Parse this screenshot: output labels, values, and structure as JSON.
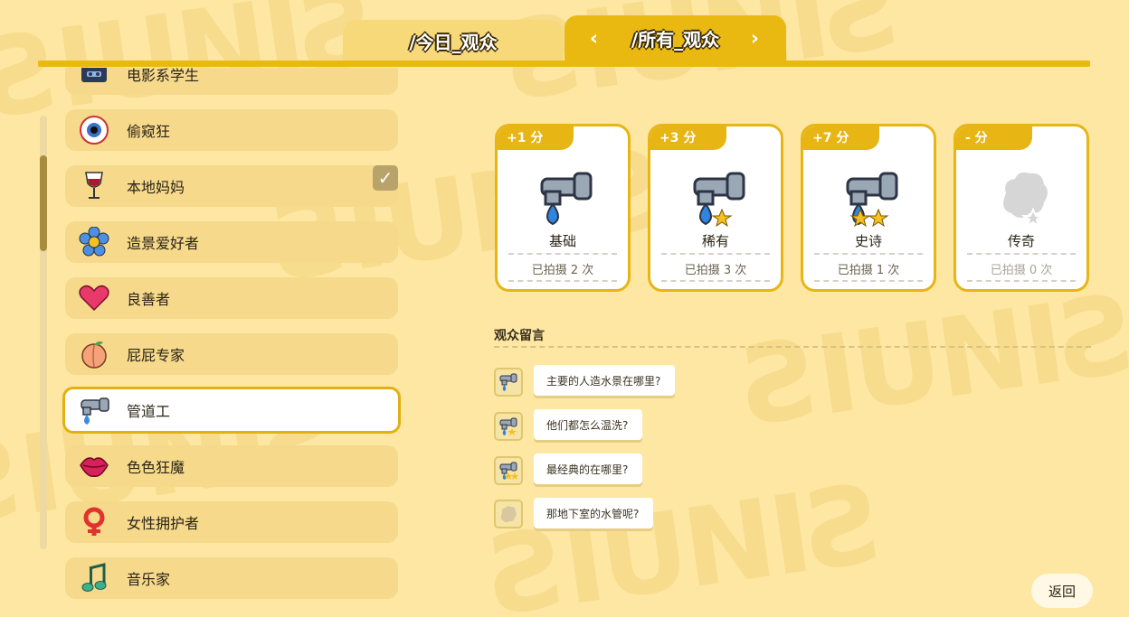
{
  "tabs": {
    "today": "/今日_观众",
    "all": "/所有_观众",
    "prev_arrow": "‹",
    "next_arrow": "›"
  },
  "audience_list": [
    {
      "label": "电影系学生",
      "icon": "cassette-icon",
      "checked": false,
      "selected": false
    },
    {
      "label": "偷窥狂",
      "icon": "eyeball-icon",
      "checked": false,
      "selected": false
    },
    {
      "label": "本地妈妈",
      "icon": "wine-glass-icon",
      "checked": true,
      "selected": false
    },
    {
      "label": "造景爱好者",
      "icon": "flower-icon",
      "checked": false,
      "selected": false
    },
    {
      "label": "良善者",
      "icon": "heart-icon",
      "checked": false,
      "selected": false
    },
    {
      "label": "屁屁专家",
      "icon": "peach-icon",
      "checked": false,
      "selected": false
    },
    {
      "label": "管道工",
      "icon": "faucet-icon",
      "checked": false,
      "selected": true
    },
    {
      "label": "色色狂魔",
      "icon": "lips-icon",
      "checked": false,
      "selected": false
    },
    {
      "label": "女性拥护者",
      "icon": "female-symbol-icon",
      "checked": false,
      "selected": false
    },
    {
      "label": "音乐家",
      "icon": "music-note-icon",
      "checked": false,
      "selected": false
    }
  ],
  "rarity_cards": [
    {
      "points": "+1 分",
      "name": "基础",
      "count": "已拍摄 2 次",
      "stars": 0,
      "locked": false
    },
    {
      "points": "+3 分",
      "name": "稀有",
      "count": "已拍摄 3 次",
      "stars": 1,
      "locked": false
    },
    {
      "points": "+7 分",
      "name": "史诗",
      "count": "已拍摄 1 次",
      "stars": 2,
      "locked": false
    },
    {
      "points": "- 分",
      "name": "传奇",
      "count": "已拍摄 0 次",
      "stars": 0,
      "locked": true
    }
  ],
  "comments": {
    "title": "观众留言",
    "items": [
      {
        "text": "主要的人造水景在哪里?",
        "stars": 0,
        "locked": false
      },
      {
        "text": "他们都怎么温洗?",
        "stars": 1,
        "locked": false
      },
      {
        "text": "最经典的在哪里?",
        "stars": 2,
        "locked": false
      },
      {
        "text": "那地下室的水管呢?",
        "stars": 0,
        "locked": true
      }
    ]
  },
  "back_button": "返回",
  "colors": {
    "background": "#fde7a3",
    "accent": "#e7b514",
    "list_item": "#f6d98b",
    "selected_bg": "#ffffff"
  }
}
